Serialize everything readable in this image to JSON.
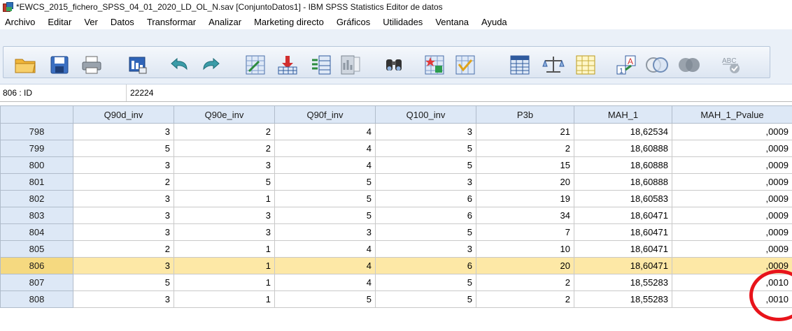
{
  "window": {
    "title": "*EWCS_2015_fichero_SPSS_04_01_2020_LD_OL_N.sav [ConjuntoDatos1] - IBM SPSS Statistics Editor de datos"
  },
  "menu": [
    {
      "label": "Archivo"
    },
    {
      "label": "Editar"
    },
    {
      "label": "Ver"
    },
    {
      "label": "Datos"
    },
    {
      "label": "Transformar"
    },
    {
      "label": "Analizar"
    },
    {
      "label": "Marketing directo"
    },
    {
      "label": "Gráficos"
    },
    {
      "label": "Utilidades"
    },
    {
      "label": "Ventana"
    },
    {
      "label": "Ayuda"
    }
  ],
  "toolbar": {
    "icons": [
      "open-folder-icon",
      "save-icon",
      "print-icon",
      "recall-dialog-icon",
      "undo-icon",
      "redo-icon",
      "goto-case-icon",
      "goto-variable-icon",
      "variables-icon",
      "run-descriptives-icon",
      "find-icon",
      "insert-cases-icon",
      "insert-variable-icon",
      "split-file-icon",
      "weight-cases-icon",
      "select-cases-icon",
      "value-labels-icon",
      "use-variable-sets-icon",
      "show-all-variables-icon",
      "spelling-icon"
    ]
  },
  "cellbar": {
    "cell_ref": "806 : ID",
    "cell_value": "22224"
  },
  "grid": {
    "columns": [
      "Q90d_inv",
      "Q90e_inv",
      "Q90f_inv",
      "Q100_inv",
      "P3b",
      "MAH_1",
      "MAH_1_Pvalue"
    ],
    "rows": [
      {
        "num": "798",
        "cells": [
          "3",
          "2",
          "4",
          "3",
          "21",
          "18,62534",
          ",0009"
        ]
      },
      {
        "num": "799",
        "cells": [
          "5",
          "2",
          "4",
          "5",
          "2",
          "18,60888",
          ",0009"
        ]
      },
      {
        "num": "800",
        "cells": [
          "3",
          "3",
          "4",
          "5",
          "15",
          "18,60888",
          ",0009"
        ]
      },
      {
        "num": "801",
        "cells": [
          "2",
          "5",
          "5",
          "3",
          "20",
          "18,60888",
          ",0009"
        ]
      },
      {
        "num": "802",
        "cells": [
          "3",
          "1",
          "5",
          "6",
          "19",
          "18,60583",
          ",0009"
        ]
      },
      {
        "num": "803",
        "cells": [
          "3",
          "3",
          "5",
          "6",
          "34",
          "18,60471",
          ",0009"
        ]
      },
      {
        "num": "804",
        "cells": [
          "3",
          "3",
          "3",
          "5",
          "7",
          "18,60471",
          ",0009"
        ]
      },
      {
        "num": "805",
        "cells": [
          "2",
          "1",
          "4",
          "3",
          "10",
          "18,60471",
          ",0009"
        ]
      },
      {
        "num": "806",
        "cells": [
          "3",
          "1",
          "4",
          "6",
          "20",
          "18,60471",
          ",0009"
        ],
        "selected": true
      },
      {
        "num": "807",
        "cells": [
          "5",
          "1",
          "4",
          "5",
          "2",
          "18,55283",
          ",0010"
        ]
      },
      {
        "num": "808",
        "cells": [
          "3",
          "1",
          "5",
          "5",
          "2",
          "18,55283",
          ",0010"
        ]
      }
    ]
  },
  "colors": {
    "selected_row": "#fde8a6",
    "header_bg": "#dde8f6",
    "annotation_circle": "#e8141b"
  }
}
